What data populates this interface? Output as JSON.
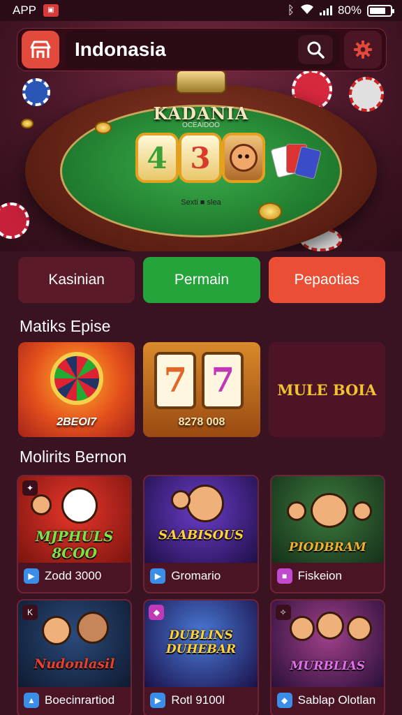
{
  "status_bar": {
    "app_label": "APP",
    "battery_text": "80%",
    "battery_level": 0.8
  },
  "header": {
    "search_value": "Indonasia"
  },
  "hero": {
    "table_title": "KADANIA",
    "table_subtitle": "OCEAIDOO",
    "reels": [
      "4",
      "3"
    ],
    "caption": "Sexti ■ slea"
  },
  "tabs": [
    {
      "label": "Kasinian",
      "color": "#5a1a28"
    },
    {
      "label": "Permain",
      "color": "#25a43c"
    },
    {
      "label": "Pepaotias",
      "color": "#ea4f36"
    }
  ],
  "featured_section": {
    "title": "Matiks Epise",
    "items": [
      {
        "label": "2BEOI7"
      },
      {
        "label": "8278 008",
        "reels": [
          "7",
          "7"
        ]
      },
      {
        "label": "MULE BOIA"
      }
    ]
  },
  "games_section": {
    "title": "Molirits Bernon",
    "games": [
      {
        "title": "MJPHULS 8COO",
        "label": "Zodd 3000",
        "icon_color": "#3a8ee8"
      },
      {
        "title": "SAABISOUS",
        "label": "Gromario",
        "icon_color": "#3a8ee8"
      },
      {
        "title": "PIODBRAM",
        "label": "Fiskeion",
        "icon_color": "#c04ad0"
      },
      {
        "title": "Nudonlasil",
        "label": "Boecinrartiod",
        "icon_color": "#3a8ee8"
      },
      {
        "title": "DUBLINS DUHEBAR",
        "label": "Rotl 9100l",
        "icon_color": "#3a8ee8"
      },
      {
        "title": "MURBLIAS",
        "label": "Sablap Olotlan",
        "icon_color": "#3a8ee8"
      }
    ]
  }
}
